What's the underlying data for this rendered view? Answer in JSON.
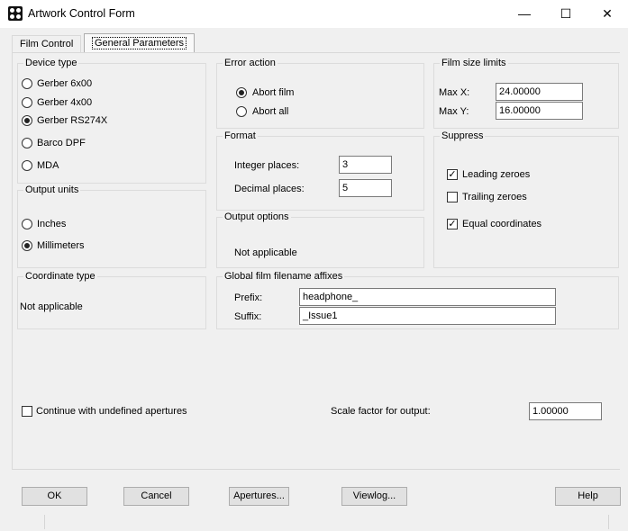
{
  "window": {
    "title": "Artwork Control Form",
    "minimize": "—",
    "maximize": "☐",
    "close": "✕"
  },
  "tabs": [
    {
      "label": "Film Control"
    },
    {
      "label": "General Parameters"
    }
  ],
  "device_type": {
    "title": "Device type",
    "options": [
      "Gerber 6x00",
      "Gerber 4x00",
      "Gerber RS274X",
      "Barco DPF",
      "MDA"
    ],
    "selected": "Gerber RS274X"
  },
  "output_units": {
    "title": "Output units",
    "options": [
      "Inches",
      "Millimeters"
    ],
    "selected": "Millimeters"
  },
  "coordinate_type": {
    "title": "Coordinate type",
    "value": "Not applicable"
  },
  "error_action": {
    "title": "Error action",
    "options": [
      "Abort film",
      "Abort all"
    ],
    "selected": "Abort film"
  },
  "format": {
    "title": "Format",
    "integer_label": "Integer places:",
    "integer_value": "3",
    "decimal_label": "Decimal places:",
    "decimal_value": "5"
  },
  "output_options": {
    "title": "Output options",
    "value": "Not applicable"
  },
  "film_size": {
    "title": "Film size limits",
    "max_x_label": "Max X:",
    "max_x_value": "24.00000",
    "max_y_label": "Max Y:",
    "max_y_value": "16.00000"
  },
  "suppress": {
    "title": "Suppress",
    "items": [
      {
        "label": "Leading zeroes",
        "checked": true
      },
      {
        "label": "Trailing zeroes",
        "checked": false
      },
      {
        "label": "Equal coordinates",
        "checked": true
      }
    ]
  },
  "affixes": {
    "title": "Global film filename affixes",
    "prefix_label": "Prefix:",
    "prefix_value": "headphone_",
    "suffix_label": "Suffix:",
    "suffix_value": "_Issue1"
  },
  "continue_undefined": {
    "label": "Continue with undefined apertures",
    "checked": false
  },
  "scale": {
    "label": "Scale factor for output:",
    "value": "1.00000"
  },
  "buttons": {
    "ok": "OK",
    "cancel": "Cancel",
    "apertures": "Apertures...",
    "viewlog": "Viewlog...",
    "help": "Help"
  }
}
